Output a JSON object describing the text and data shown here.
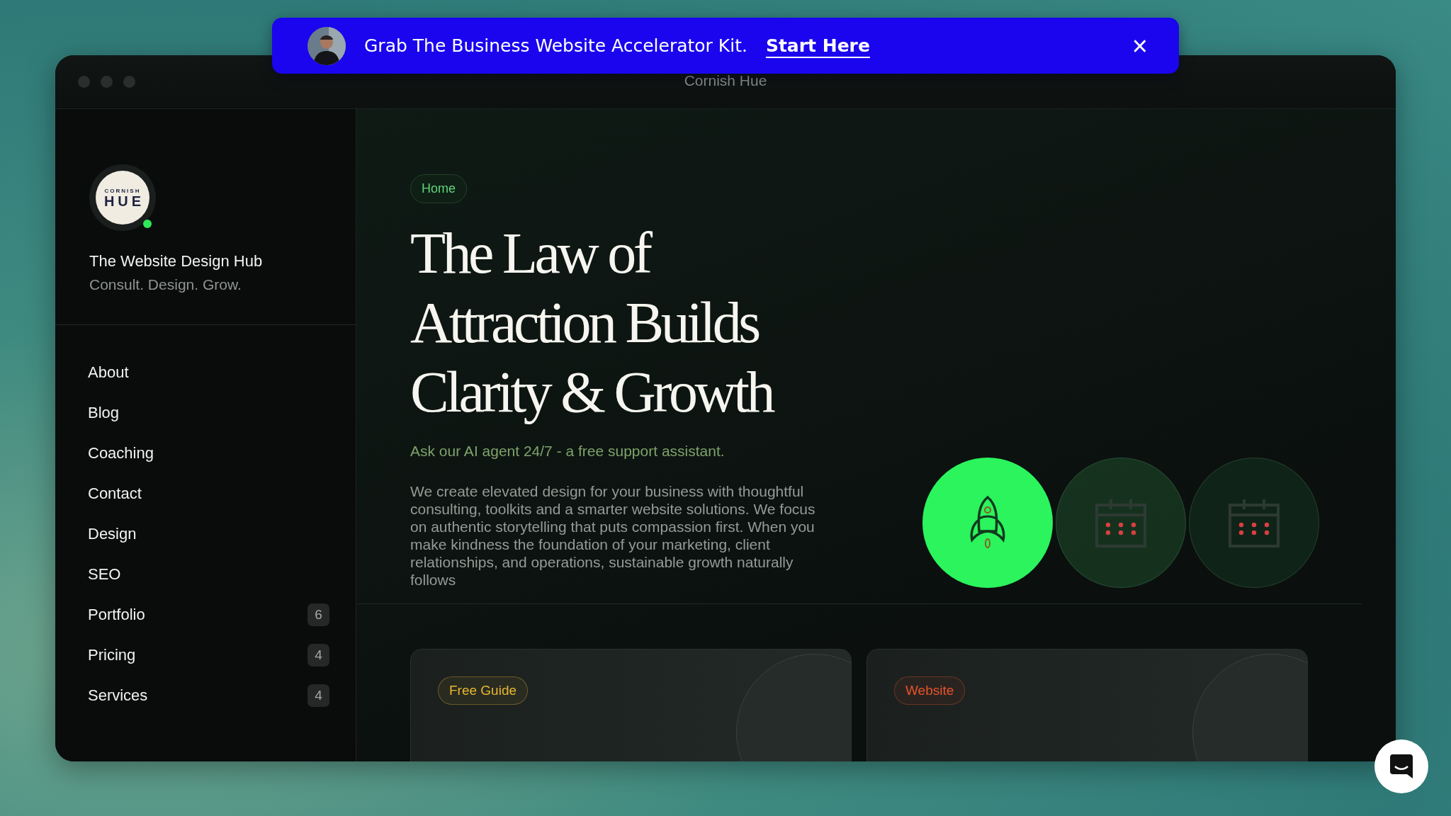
{
  "banner": {
    "message": "Grab The Business Website Accelerator Kit.",
    "link": "Start Here",
    "close": "×"
  },
  "window": {
    "title": "Cornish Hue"
  },
  "sidebar": {
    "logo": {
      "top": "CORNISH",
      "main": "HUE"
    },
    "online": true,
    "name": "The Website Design Hub",
    "tagline": "Consult. Design. Grow.",
    "items": [
      {
        "label": "About"
      },
      {
        "label": "Blog"
      },
      {
        "label": "Coaching"
      },
      {
        "label": "Contact"
      },
      {
        "label": "Design"
      },
      {
        "label": "SEO"
      },
      {
        "label": "Portfolio",
        "count": "6"
      },
      {
        "label": "Pricing",
        "count": "4"
      },
      {
        "label": "Services",
        "count": "4"
      }
    ]
  },
  "hero": {
    "breadcrumb": "Home",
    "title_lines": [
      "The Law of",
      "Attraction Builds",
      "Clarity & Growth"
    ],
    "subtitle": "Ask our AI agent 24/7 - a free support assistant.",
    "body": "We create elevated design for your business with thoughtful consulting, toolkits and a smarter website solutions. We focus on authentic storytelling that puts compassion first. When you make kindness the foundation of your marketing, client relationships, and operations, sustainable growth naturally follows",
    "steps": [
      {
        "kind": "rocket",
        "selected": true
      },
      {
        "kind": "calendar",
        "selected": false
      },
      {
        "kind": "calendar",
        "selected": false
      }
    ]
  },
  "cards": [
    {
      "tag": "Free Guide",
      "color": "#e8b930"
    },
    {
      "tag": "Website",
      "color": "#e8532a"
    }
  ]
}
